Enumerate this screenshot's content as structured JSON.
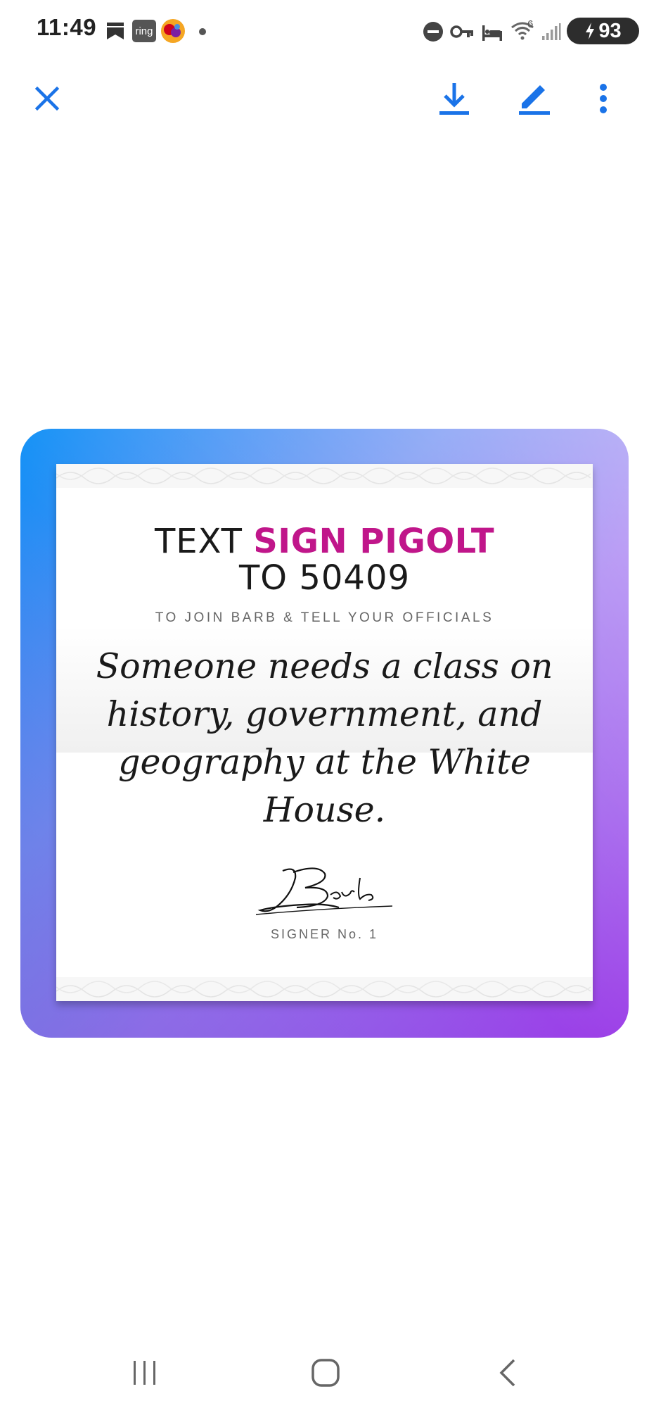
{
  "status_bar": {
    "time": "11:49",
    "left_icons": [
      "bookmark-notification-icon",
      "ring-app-icon",
      "game-app-icon",
      "more-notifications-dot-icon"
    ],
    "ring_badge": "ring",
    "right_icons": [
      "do-not-disturb-icon",
      "vpn-key-icon",
      "sleep-bed-icon",
      "wifi-icon",
      "signal-icon"
    ],
    "wifi_badge": "6",
    "battery_level": "93"
  },
  "app_bar": {
    "icons": [
      "close-icon",
      "download-icon",
      "edit-pen-icon",
      "more-vert-icon"
    ],
    "accent_color": "#1a73e8"
  },
  "card": {
    "headline_prefix": "TEXT",
    "headline_accent": "SIGN PIGOLT",
    "headline_line2": "TO 50409",
    "subline": "TO JOIN BARB & TELL YOUR OFFICIALS",
    "quote": "Someone needs a class on history, government, and geography at the White House.",
    "signature_name": "Barb",
    "signer_label": "SIGNER No. 1",
    "accent_color": "#c0168a",
    "frame_gradient": [
      "#0d8ff6",
      "#9b6ff0",
      "#9a3ae6"
    ]
  },
  "nav_bar": {
    "icons": [
      "recent-apps-icon",
      "home-icon",
      "back-icon"
    ]
  }
}
